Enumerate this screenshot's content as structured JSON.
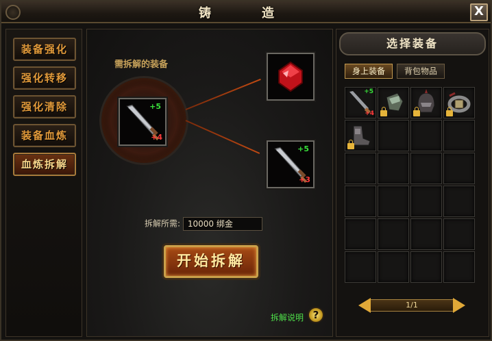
{
  "window": {
    "title": "铸　造",
    "close_label": "X"
  },
  "menu": {
    "items": [
      {
        "label": "装备强化",
        "active": false
      },
      {
        "label": "强化转移",
        "active": false
      },
      {
        "label": "强化清除",
        "active": false
      },
      {
        "label": "装备血炼",
        "active": false
      },
      {
        "label": "血炼拆解",
        "active": true
      }
    ]
  },
  "center": {
    "need_label": "需拆解的装备",
    "source_item": {
      "icon": "sword-icon",
      "plus": "+5",
      "blood": "+4"
    },
    "result_gem": {
      "icon": "red-gem-icon"
    },
    "result_item": {
      "icon": "sword-icon",
      "plus": "+5",
      "blood": "+3"
    },
    "cost_label": "拆解所需:",
    "cost_value": "10000 绑金",
    "start_button": "开始拆解",
    "help_link": "拆解说明",
    "help_icon": "?"
  },
  "right": {
    "title": "选择装备",
    "tabs": [
      {
        "label": "身上装备",
        "active": true
      },
      {
        "label": "背包物品",
        "active": false
      }
    ],
    "grid": {
      "items": [
        {
          "icon": "sword-icon",
          "plus": "+5",
          "blood": "+4",
          "locked": false
        },
        {
          "icon": "glove-icon",
          "locked": true
        },
        {
          "icon": "helmet-icon",
          "locked": true
        },
        {
          "icon": "belt-icon",
          "locked": true
        },
        {
          "icon": "boot-icon",
          "locked": true
        }
      ]
    },
    "pager": "1/1"
  }
}
